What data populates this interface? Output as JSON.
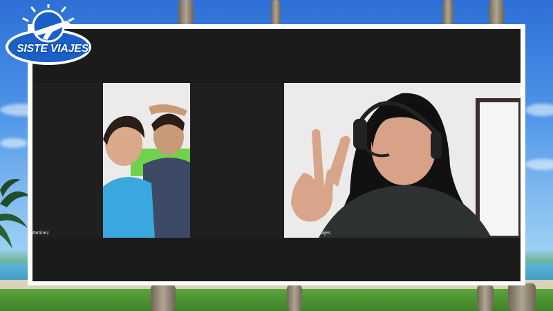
{
  "brand": {
    "name": "SISTE VIAJES",
    "primary_color": "#1b5fc7",
    "accent_color": "#ffffff"
  },
  "call": {
    "participants": [
      {
        "name_label": "Martinez",
        "tile": "left"
      },
      {
        "name_label": "Katherine sisteviajes",
        "tile": "right"
      }
    ]
  }
}
